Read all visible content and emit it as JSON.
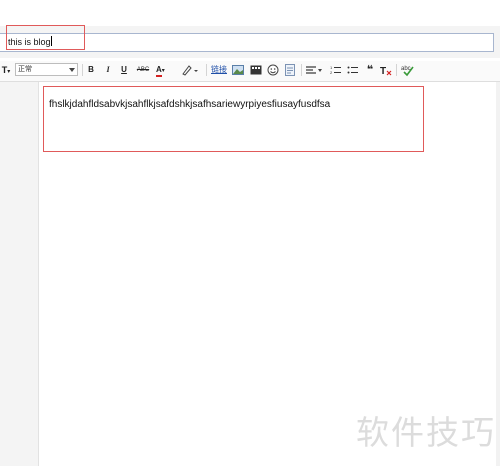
{
  "post": {
    "title_value": "this is blog",
    "body_text": "fhslkjdahfldsabvkjsahflkjsafdshkjsafhsariewyrpiyesfiusayfusdfsa"
  },
  "toolbar": {
    "font_family_icon": "T",
    "paragraph_format": "正常",
    "bold": "B",
    "italic": "I",
    "underline": "U",
    "strikethrough": "ABC",
    "font_color": "A",
    "link": "链接",
    "quote": "❝",
    "icons": [
      "font-family-icon",
      "bold-icon",
      "italic-icon",
      "underline-icon",
      "strikethrough-icon",
      "font-color-icon",
      "highlight-icon",
      "link-icon",
      "image-icon",
      "video-icon",
      "emoji-icon",
      "code-icon",
      "align-icon",
      "ordered-list-icon",
      "unordered-list-icon",
      "quote-icon",
      "clear-format-icon",
      "spellcheck-icon"
    ]
  },
  "colors": {
    "annotation_red": "#e05a5a",
    "font_color_underline": "#d42020",
    "spellcheck_green": "#3a9a3a"
  },
  "watermark": "软件技巧"
}
